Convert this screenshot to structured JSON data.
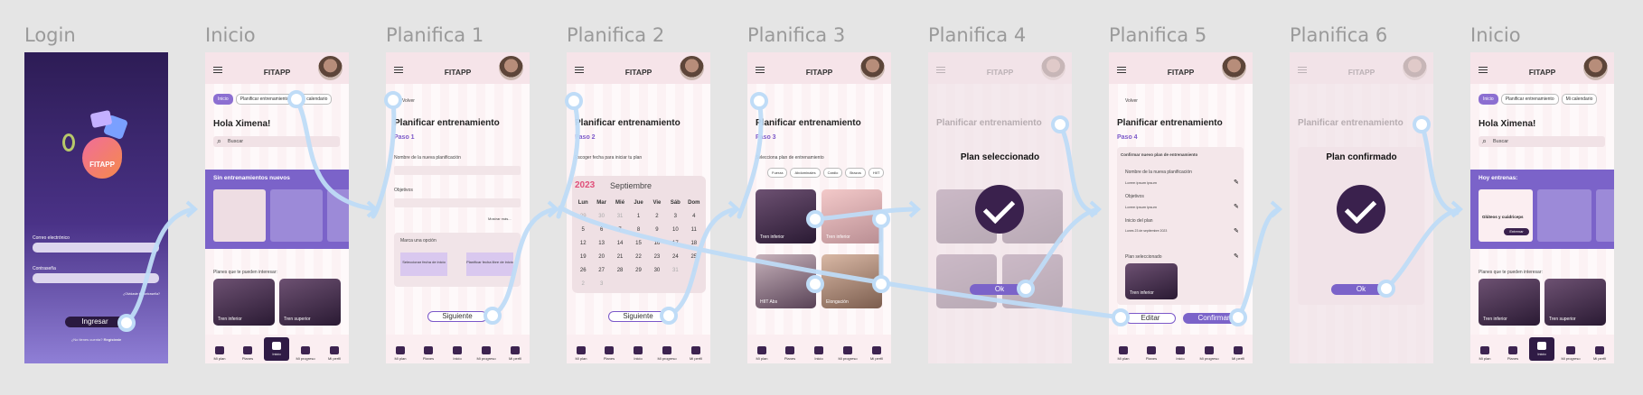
{
  "frames": [
    {
      "title": "Login"
    },
    {
      "title": "Inicio"
    },
    {
      "title": "Planifica 1"
    },
    {
      "title": "Planifica 2"
    },
    {
      "title": "Planifica 3"
    },
    {
      "title": "Planifica 4"
    },
    {
      "title": "Planifica 5"
    },
    {
      "title": "Planifica 6"
    },
    {
      "title": "Inicio"
    }
  ],
  "app_title": "FITAPP",
  "login": {
    "logo_text": "FITAPP",
    "email_label": "Correo electrónico",
    "password_label": "Contraseña",
    "forgot": "¿Olvidaste tu contraseña?",
    "login_button": "Ingresar",
    "no_account": "¿No tienes cuenta?",
    "register": "Regístrate"
  },
  "home": {
    "chips": [
      "Inicio",
      "Planificar entrenamiento",
      "Mi calendario"
    ],
    "greeting": "Hola Ximena!",
    "search_placeholder": "Buscar",
    "banner_title": "Sin entrenamientos nuevos",
    "plans_title": "Planes que te pueden interesar:",
    "cards": [
      "Tren inferior",
      "Tren superior"
    ]
  },
  "home2": {
    "banner_title": "Hoy entrenas:",
    "card_title": "Glúteos y cuádriceps",
    "card_button": "Entrenar"
  },
  "plan": {
    "back": "Volver",
    "title": "Planificar entrenamiento",
    "step1": "Paso 1",
    "step2": "Paso 2",
    "step3": "Paso 3",
    "step4": "Paso 4",
    "name_label": "Nombre de la nueva planificación",
    "goals_label": "Objetivos",
    "see_more": "Mostrar más...",
    "option_label": "Marca una opción",
    "option1": "Seleccionar fecha de inicio",
    "option2": "Planificar fecha libre de inicio",
    "next": "Siguiente",
    "choose_date": "Escoger fecha para iniciar tu plan",
    "year": "2023",
    "month": "Septiembre",
    "weekdays": [
      "Lun",
      "Mar",
      "Mié",
      "Jue",
      "Vie",
      "Sáb",
      "Dom"
    ],
    "days": [
      "29",
      "30",
      "31",
      "1",
      "2",
      "3",
      "4",
      "5",
      "6",
      "7",
      "8",
      "9",
      "10",
      "11",
      "12",
      "13",
      "14",
      "15",
      "16",
      "17",
      "18",
      "19",
      "20",
      "21",
      "22",
      "23",
      "24",
      "25",
      "26",
      "27",
      "28",
      "29",
      "30",
      "31",
      "1",
      "2",
      "3"
    ],
    "select_plan": "Selecciona plan de entrenamiento",
    "filters": [
      "Fuerza",
      "Abdominales",
      "Cardio",
      "Brazos",
      "HIIT"
    ],
    "plans": [
      "Tren inferior",
      "Tren inferior",
      "HIIT Abs",
      "Elongación"
    ],
    "selected_modal": "Plan seleccionado",
    "ok": "Ok",
    "confirm_header": "Confirmar nuevo plan de entrenamiento",
    "confirm_name_label": "Nombre de la nueva planificación",
    "confirm_goals_label": "Objetivos",
    "confirm_start_label": "Inicio del plan",
    "confirm_plan_label": "Plan seleccionado",
    "lorem": "Lorem ipsum ipsum",
    "start_value": "Lunes 23 de septiembre 2023",
    "edit": "Editar",
    "confirm": "Confirmar",
    "confirmed_modal": "Plan confirmado"
  },
  "nav": [
    "Mi plan",
    "Planes",
    "Inicio",
    "Mi progreso",
    "Mi perfil"
  ],
  "colors": {
    "brand": "#3a214d",
    "accent": "#7b63c9",
    "wire": "#bfdcf7"
  }
}
